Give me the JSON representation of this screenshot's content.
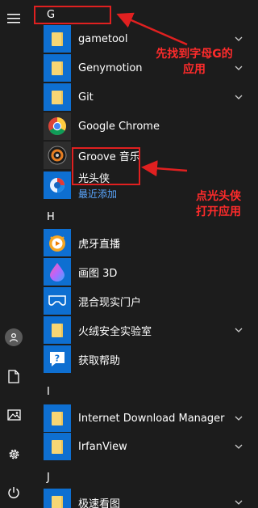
{
  "rail": {
    "icons": [
      "hamburger-menu-icon",
      "user-avatar-icon",
      "documents-icon",
      "pictures-icon",
      "settings-gear-icon",
      "power-icon"
    ]
  },
  "sections": [
    {
      "letter": "G"
    },
    {
      "letter": "H"
    },
    {
      "letter": "I"
    },
    {
      "letter": "J"
    }
  ],
  "apps": {
    "gametool": {
      "label": "gametool"
    },
    "genymotion": {
      "label": "Genymotion"
    },
    "git": {
      "label": "Git"
    },
    "chrome": {
      "label": "Google Chrome"
    },
    "groove": {
      "label": "Groove 音乐"
    },
    "guangtouxia": {
      "label": "光头侠",
      "sub": "最近添加"
    },
    "huya": {
      "label": "虎牙直播"
    },
    "paint3d": {
      "label": "画图 3D"
    },
    "mixedreality": {
      "label": "混合现实门户"
    },
    "huorong": {
      "label": "火绒安全实验室"
    },
    "gethelp": {
      "label": "获取帮助"
    },
    "idm": {
      "label": "Internet Download Manager"
    },
    "irfanview": {
      "label": "IrfanView"
    },
    "jisu": {
      "label": "极速看图"
    }
  },
  "annotations": {
    "find_g": "先找到字母G的应用",
    "click_app": "点光头侠打开应用",
    "color": "#e02020"
  }
}
